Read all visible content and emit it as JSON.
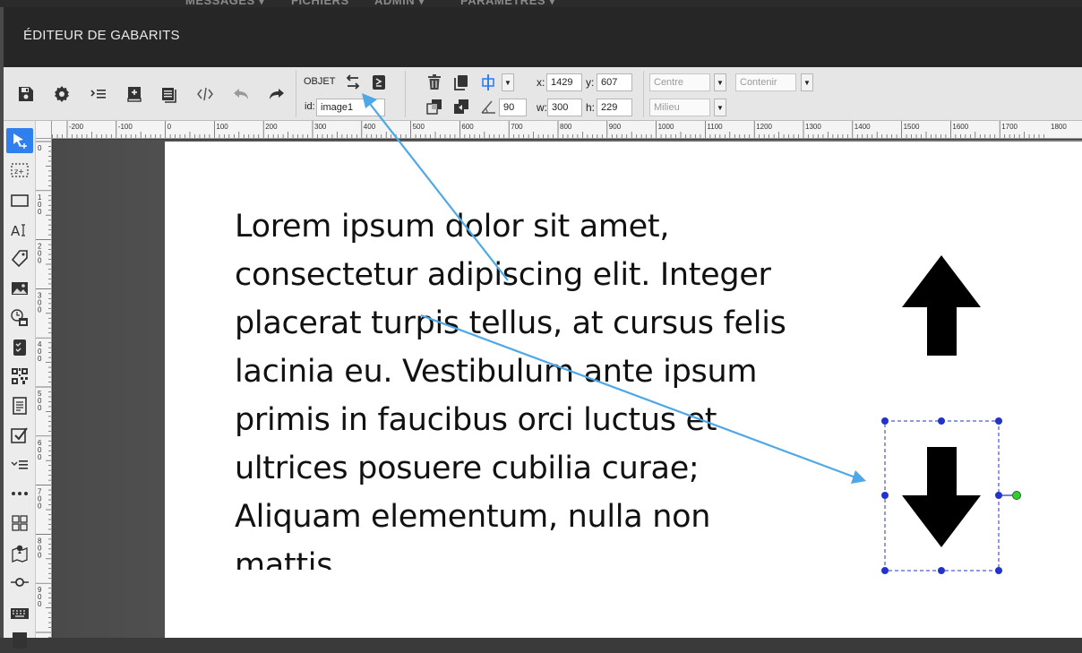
{
  "topnav": [
    "MESSAGES ▾",
    "FICHIERS",
    "ADMIN ▾",
    "PARAMÈTRES ▾"
  ],
  "window_title": "ÉDITEUR DE GABARITS",
  "toolbar": {
    "object_label": "OBJET",
    "id_label": "id:",
    "id_value": "image1",
    "angle_value": "90",
    "x_label": "x:",
    "x_value": "1429",
    "y_label": "y:",
    "y_value": "607",
    "w_label": "w:",
    "w_value": "300",
    "h_label": "h:",
    "h_value": "229",
    "halign_value": "Centre",
    "fit_value": "Contenir",
    "valign_value": "Milieu"
  },
  "ruler_h_labels": [
    "-200",
    "-100",
    "0",
    "100",
    "200",
    "300",
    "400",
    "500",
    "600",
    "700",
    "800",
    "900",
    "1000",
    "1100",
    "1200",
    "1300",
    "1400",
    "1500",
    "1600",
    "1700",
    "1800"
  ],
  "ruler_v_labels": [
    "0",
    "100",
    "200",
    "300",
    "400",
    "500",
    "600",
    "700",
    "800",
    "900"
  ],
  "canvas_text": "Lorem ipsum dolor sit amet, consectetur adipiscing elit. Integer placerat turpis tellus, at cursus felis lacinia eu. Vestibulum ante ipsum primis in faucibus orci luctus et ultrices posuere cubilia curae; Aliquam elementum, nulla non mattis",
  "colors": {
    "accent": "#2f80ed",
    "selection": "#2233cc",
    "rotate_handle": "#33cc33",
    "annotation_arrow": "#4ea8e8"
  }
}
